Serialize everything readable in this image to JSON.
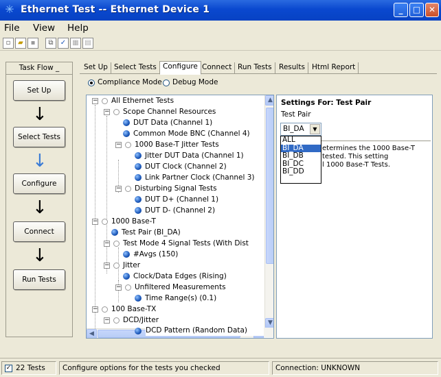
{
  "window": {
    "title": "Ethernet Test -- Ethernet Device 1"
  },
  "menu": {
    "file": "File",
    "view": "View",
    "help": "Help"
  },
  "taskflow": {
    "header": "Task Flow",
    "buttons": [
      "Set Up",
      "Select Tests",
      "Configure",
      "Connect",
      "Run Tests"
    ]
  },
  "tabs": [
    "Set Up",
    "Select Tests",
    "Configure",
    "Connect",
    "Run Tests",
    "Results",
    "Html Report"
  ],
  "mode": {
    "compliance": "Compliance Mode",
    "debug": "Debug Mode"
  },
  "tree": [
    "All Ethernet Tests",
    "Scope Channel Resources",
    "DUT Data (Channel 1)",
    "Common Mode BNC (Channel 4)",
    "1000 Base-T Jitter Tests",
    "Jitter DUT Data (Channel 1)",
    "DUT Clock (Channel 2)",
    "Link Partner Clock (Channel 3)",
    "Disturbing Signal Tests",
    "DUT D+ (Channel 1)",
    "DUT D- (Channel 2)",
    "1000 Base-T",
    "Test Pair (BI_DA)",
    "Test Mode 4 Signal Tests (With Dist",
    "#Avgs (150)",
    "Jitter",
    "Clock/Data Edges (Rising)",
    "Unfiltered Measurements",
    "Time Range(s) (0.1)",
    "100 Base-TX",
    "DCD/Jitter",
    "DCD Pattern (Random Data)"
  ],
  "settings": {
    "title": "Settings For: Test Pair",
    "label": "Test Pair",
    "value": "BI_DA",
    "options": [
      "ALL",
      "BI_DA",
      "BI_DB",
      "BI_DC",
      "BI_DD"
    ],
    "desc_lines": [
      "etermines the 1000 Base-T",
      "tested.  This setting",
      "l 1000 Base-T Tests."
    ]
  },
  "status": {
    "tests": "22 Tests",
    "message": "Configure options for the tests you checked",
    "connection": "Connection: UNKNOWN"
  }
}
